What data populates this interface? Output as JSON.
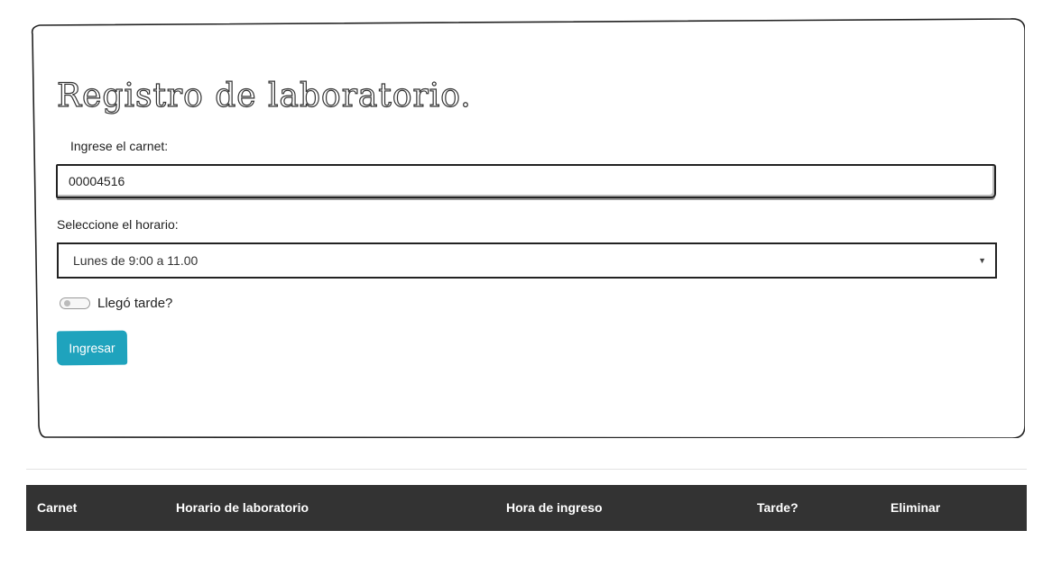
{
  "form": {
    "title": "Registro de laboratorio.",
    "carnet_label": "Ingrese el carnet:",
    "carnet_value": "00004516",
    "horario_label": "Seleccione el horario:",
    "horario_selected": "Lunes de 9:00 a 11.00",
    "late_toggle_label": "Llegó tarde?",
    "late_toggle_on": false,
    "submit_label": "Ingresar",
    "accent_color": "#1fa3bd"
  },
  "table": {
    "header_color": "#333333",
    "columns": [
      "Carnet",
      "Horario de laboratorio",
      "Hora de ingreso",
      "Tarde?",
      "Eliminar"
    ]
  }
}
